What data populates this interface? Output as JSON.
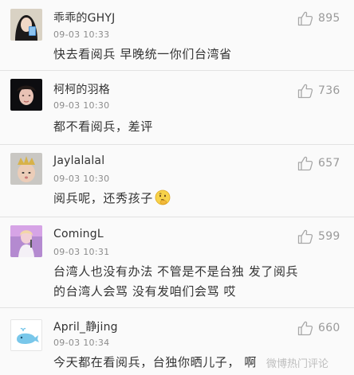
{
  "colors": {
    "background": "#fafafa",
    "divider": "#e2e2e2",
    "text": "#333333",
    "meta": "#8c8c8c",
    "like": "#9a9a9a"
  },
  "watermark": "微博热门评论",
  "comments": [
    {
      "username": "乖乖的GHYJ",
      "timestamp": "09-03 10:33",
      "likes": "895",
      "lines": [
        "快去看阅兵 早晚统一你们台湾省"
      ],
      "avatar_icon": "avatar-photo"
    },
    {
      "username": "柯柯的羽格",
      "timestamp": "09-03 10:30",
      "likes": "736",
      "lines": [
        "都不看阅兵，差评"
      ],
      "avatar_icon": "avatar-photo"
    },
    {
      "username": "Jaylalalal",
      "timestamp": "09-03 10:30",
      "likes": "657",
      "lines": [
        "阅兵呢，还秀孩子"
      ],
      "emoji": "thinking-face-icon",
      "avatar_icon": "avatar-photo"
    },
    {
      "username": "ComingL",
      "timestamp": "09-03 10:31",
      "likes": "599",
      "lines": [
        "台湾人也没有办法  不管是不是台独  发了阅兵",
        "的台湾人会骂  没有发咱们会骂  哎"
      ],
      "avatar_icon": "avatar-photo"
    },
    {
      "username": "April_静jing",
      "timestamp": "09-03 10:34",
      "likes": "660",
      "lines": [
        "今天都在看阅兵，台独你晒儿子，   啊"
      ],
      "avatar_icon": "whale-avatar"
    }
  ]
}
